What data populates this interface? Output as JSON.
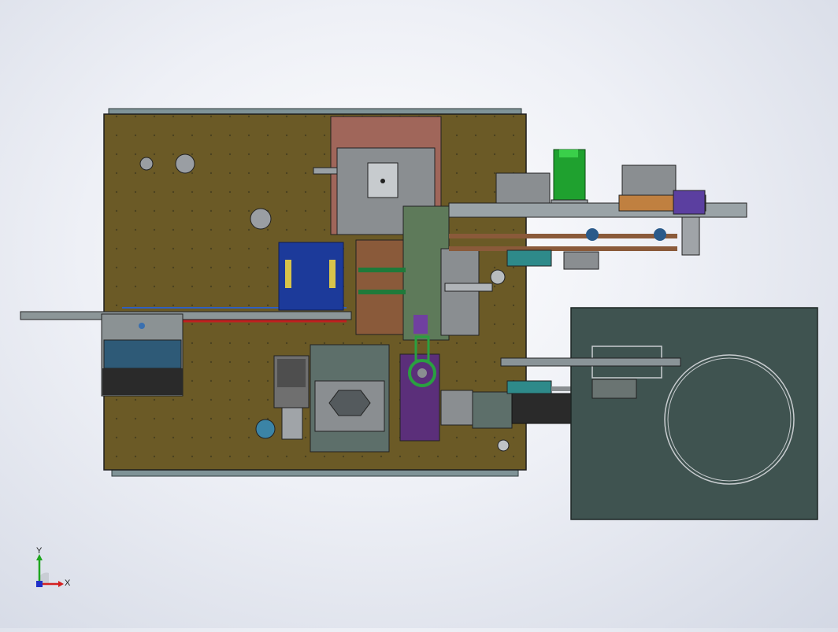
{
  "viewport": {
    "background_center": "#ffffff",
    "background_edge": "#d3d8e4"
  },
  "model": {
    "base_plate_color": "#6b5a26",
    "turntable_plate_color": "#3f5350",
    "components": [
      "base-plate",
      "rear-rail",
      "front-rail",
      "left-feed-rail",
      "left-feed-block",
      "blue-tray",
      "slide-assembly",
      "center-mechanism",
      "stepper-motor",
      "purple-cam-plate",
      "servo-motor",
      "green-motor",
      "right-arm-conveyor",
      "turntable-plate",
      "turntable-ring"
    ]
  },
  "triad": {
    "x_label": "X",
    "y_label": "Y",
    "x_color": "#d42020",
    "y_color": "#1ea61e",
    "z_color": "#2030c8"
  }
}
